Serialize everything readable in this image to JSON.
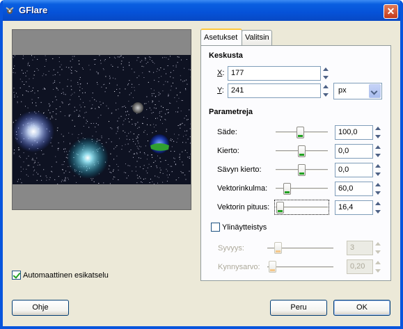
{
  "window": {
    "title": "GFlare"
  },
  "preview": {
    "auto_preview_label": "Automaattinen esikatselu",
    "auto_preview_checked": true
  },
  "tabs": [
    {
      "label": "Asetukset",
      "active": true
    },
    {
      "label": "Valitsin",
      "active": false
    }
  ],
  "center": {
    "title": "Keskusta",
    "x_label": "X:",
    "x_value": "177",
    "y_label": "Y:",
    "y_value": "241",
    "unit": "px"
  },
  "params": {
    "title": "Parametreja",
    "items": [
      {
        "label": "Säde:",
        "value": "100,0",
        "level": 0.47
      },
      {
        "label": "Kierto:",
        "value": "0,0",
        "level": 0.5
      },
      {
        "label": "Sävyn kierto:",
        "value": "0,0",
        "level": 0.5
      },
      {
        "label": "Vektorinkulma:",
        "value": "60,0",
        "level": 0.17
      },
      {
        "label": "Vektorin pituus:",
        "value": "16,4",
        "level": 0.02
      }
    ]
  },
  "oversampling": {
    "label": "Ylinäytteistys",
    "checked": false,
    "depth_label": "Syvyys:",
    "depth_value": "3",
    "depth_level": 0.12,
    "threshold_label": "Kynnysarvo:",
    "threshold_value": "0,20",
    "threshold_level": 0.02
  },
  "buttons": {
    "help": "Ohje",
    "cancel": "Peru",
    "ok": "OK"
  }
}
